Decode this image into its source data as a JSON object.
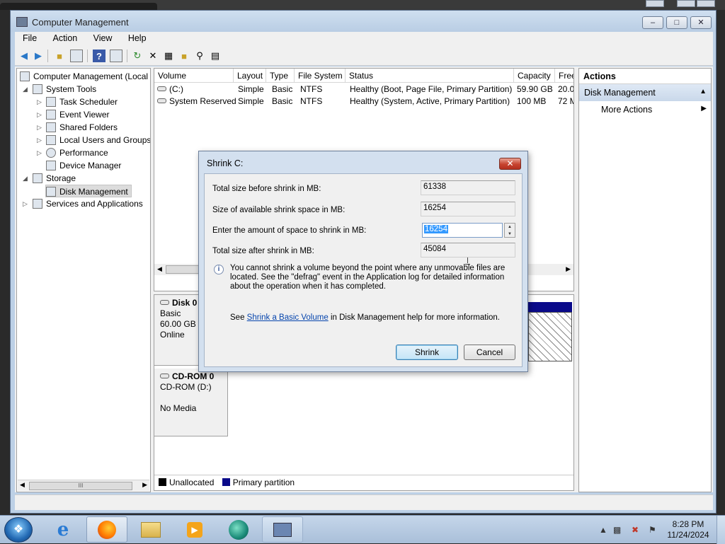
{
  "window": {
    "title": "Computer Management"
  },
  "menu": [
    "File",
    "Action",
    "View",
    "Help"
  ],
  "toolbar": {
    "icons": [
      "back-arrow-icon",
      "forward-arrow-icon",
      "up-folder-icon",
      "show-hide-tree-icon",
      "help-icon",
      "show-hide-action-pane-icon",
      "refresh-icon",
      "delete-icon",
      "properties-icon",
      "open-icon",
      "search-icon",
      "export-icon"
    ]
  },
  "tree": {
    "root": "Computer Management (Local",
    "system_tools": "System Tools",
    "task_scheduler": "Task Scheduler",
    "event_viewer": "Event Viewer",
    "shared_folders": "Shared Folders",
    "local_users": "Local Users and Groups",
    "performance": "Performance",
    "device_manager": "Device Manager",
    "storage": "Storage",
    "disk_management": "Disk Management",
    "services": "Services and Applications",
    "scroll_grip": "III"
  },
  "volumes": {
    "columns": [
      "Volume",
      "Layout",
      "Type",
      "File System",
      "Status",
      "Capacity",
      "Free"
    ],
    "rows": [
      [
        "(C:)",
        "Simple",
        "Basic",
        "NTFS",
        "Healthy (Boot, Page File, Primary Partition)",
        "59.90 GB",
        "20.0"
      ],
      [
        "System Reserved",
        "Simple",
        "Basic",
        "NTFS",
        "Healthy (System, Active, Primary Partition)",
        "100 MB",
        "72 M"
      ]
    ]
  },
  "disks": {
    "disk0": {
      "name": "Disk 0",
      "type": "Basic",
      "size": "60.00 GB",
      "state": "Online"
    },
    "cdrom": {
      "name": "CD-ROM 0",
      "type": "CD-ROM (D:)",
      "state": "No Media"
    }
  },
  "legend": {
    "unallocated": "Unallocated",
    "primary": "Primary partition",
    "unallocated_color": "#000000",
    "primary_color": "#0a0a8a"
  },
  "actions": {
    "header": "Actions",
    "section": "Disk Management",
    "more": "More Actions"
  },
  "dialog": {
    "title": "Shrink C:",
    "total_before_label": "Total size before shrink in MB:",
    "total_before_value": "61338",
    "available_label": "Size of available shrink space in MB:",
    "available_value": "16254",
    "amount_label": "Enter the amount of space to shrink in MB:",
    "amount_value": "16254",
    "after_label": "Total size after shrink in MB:",
    "after_value": "45084",
    "note": "You cannot shrink a volume beyond the point where any unmovable files are located. See the \"defrag\" event in the Application log for detailed information about the operation when it has completed.",
    "see_prefix": "See",
    "see_link": "Shrink a Basic Volume",
    "see_suffix": "in Disk Management help for more information.",
    "shrink_button": "Shrink",
    "cancel_button": "Cancel"
  },
  "taskbar": {
    "apps": [
      "internet-explorer-icon",
      "firefox-icon",
      "windows-explorer-icon",
      "media-player-icon",
      "browser-icon",
      "computer-management-icon"
    ],
    "time": "8:28 PM",
    "date": "11/24/2024"
  }
}
